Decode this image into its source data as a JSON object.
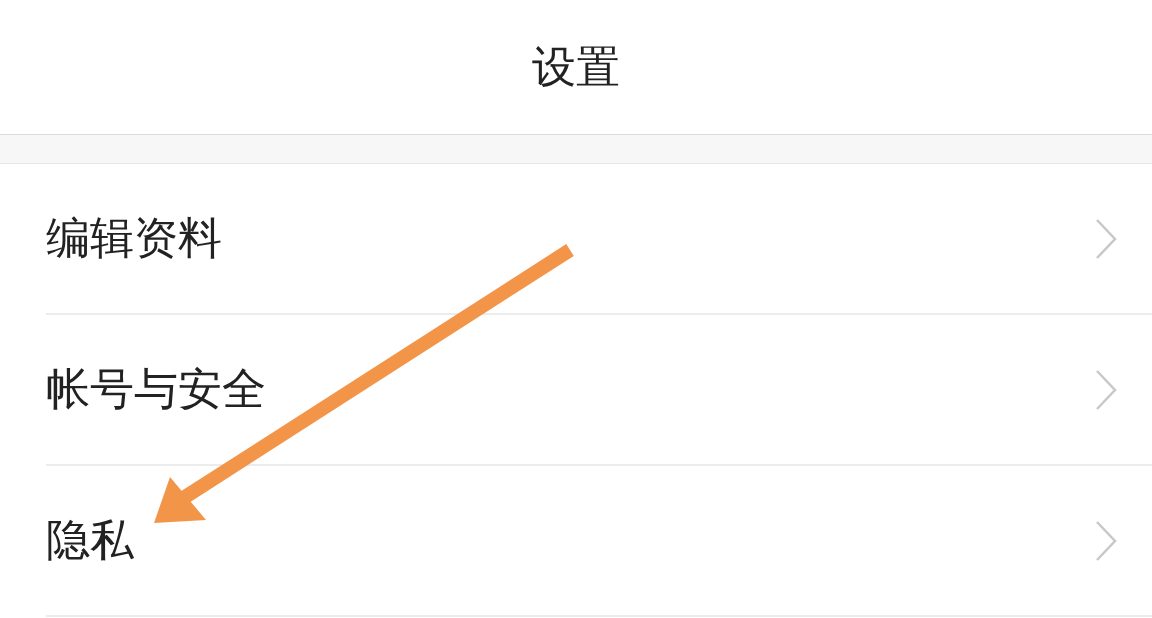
{
  "header": {
    "title": "设置"
  },
  "items": [
    {
      "label": "编辑资料"
    },
    {
      "label": "帐号与安全"
    },
    {
      "label": "隐私"
    }
  ]
}
